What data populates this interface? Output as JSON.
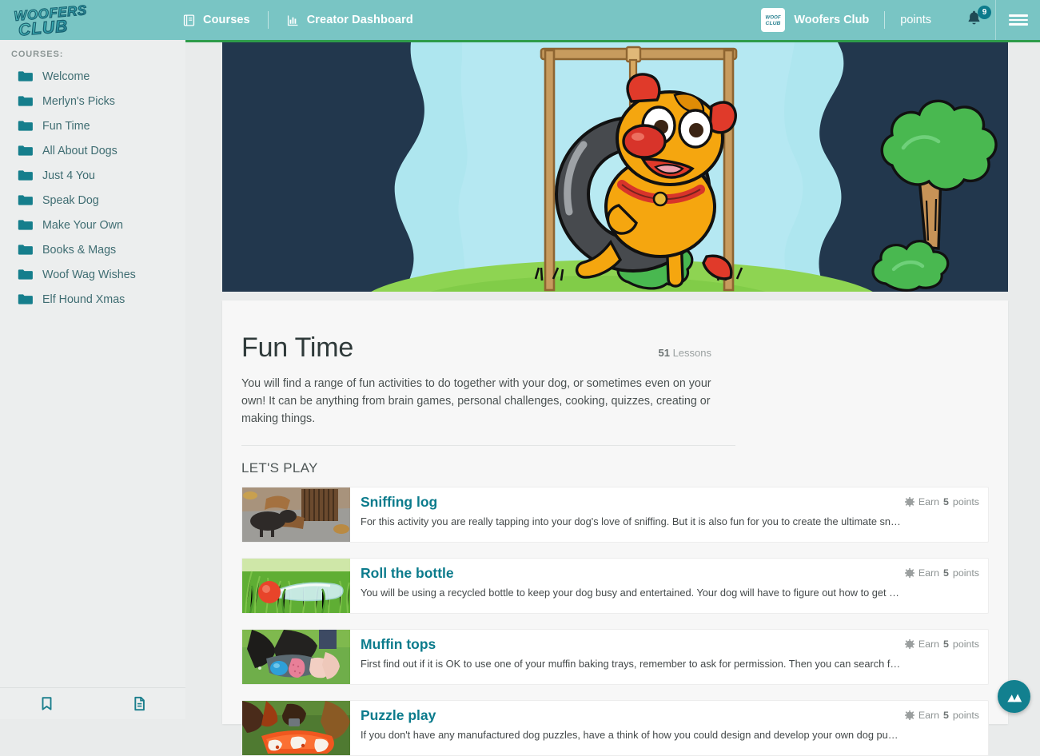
{
  "brand": {
    "logo_text_line1": "WOOFERS",
    "logo_text_line2": "CLUB",
    "accent_teal": "#79c5c4",
    "accent_deep_teal": "#0b7b8c",
    "accent_green": "#2e9c4a",
    "hero_bg": "#22374d"
  },
  "header": {
    "nav": [
      {
        "label": "Courses",
        "icon": "book-icon"
      },
      {
        "label": "Creator Dashboard",
        "icon": "bar-chart-icon"
      }
    ],
    "user_name": "Woofers Club",
    "points_label": "points",
    "notification_count": "9",
    "bell_icon": "bell-icon",
    "menu_icon": "hamburger-menu-icon",
    "avatar_icon": "woofers-club-avatar"
  },
  "sidebar": {
    "heading": "COURSES:",
    "items": [
      {
        "label": "Welcome"
      },
      {
        "label": "Merlyn's Picks"
      },
      {
        "label": "Fun Time"
      },
      {
        "label": "All About Dogs"
      },
      {
        "label": "Just 4 You"
      },
      {
        "label": "Speak Dog"
      },
      {
        "label": "Make Your Own"
      },
      {
        "label": "Books & Mags"
      },
      {
        "label": "Woof Wag Wishes"
      },
      {
        "label": "Elf Hound Xmas"
      }
    ],
    "footer_icons": [
      {
        "name": "bookmark-icon"
      },
      {
        "name": "document-icon"
      }
    ]
  },
  "hero": {
    "illustration": "cartoon-dog-on-tire-swing"
  },
  "course": {
    "title": "Fun Time",
    "lesson_count": "51",
    "lesson_count_label": "Lessons",
    "description": "You will find a range of fun activities to do together with your dog, or sometimes even on your own! It can be anything from brain games, personal challenges, cooking, quizzes, creating or making things.",
    "section_heading": "LET'S PLAY"
  },
  "lessons": [
    {
      "title": "Sniffing log",
      "description": "For this activity you are really tapping into your dog's love of sniffing. But it is also fun for you to create the ultimate sniffing log that …",
      "earn_prefix": "Earn",
      "earn_value": "5",
      "earn_suffix": "points",
      "thumb": "dachshund-sniffing-log-photo"
    },
    {
      "title": "Roll the bottle",
      "description": "You will be using a recycled bottle to keep your dog busy and entertained. Your dog will have to figure out how to get the treats out …",
      "earn_prefix": "Earn",
      "earn_value": "5",
      "earn_suffix": "points",
      "thumb": "bottle-in-grass-photo"
    },
    {
      "title": "Muffin tops",
      "description": "First find out if it is OK to use one of your muffin baking trays, remember to ask for permission. Then you can search for the rest of th…",
      "earn_prefix": "Earn",
      "earn_value": "5",
      "earn_suffix": "points",
      "thumb": "black-dog-with-muffin-tray-photo"
    },
    {
      "title": "Puzzle play",
      "description": "If you don't have any manufactured dog puzzles, have a think of how you could design and develop your own dog puzzle. The puzzl…",
      "earn_prefix": "Earn",
      "earn_value": "5",
      "earn_suffix": "points",
      "thumb": "dog-with-orange-puzzle-toy-photo"
    }
  ],
  "fab": {
    "icon": "image-mountains-icon"
  }
}
